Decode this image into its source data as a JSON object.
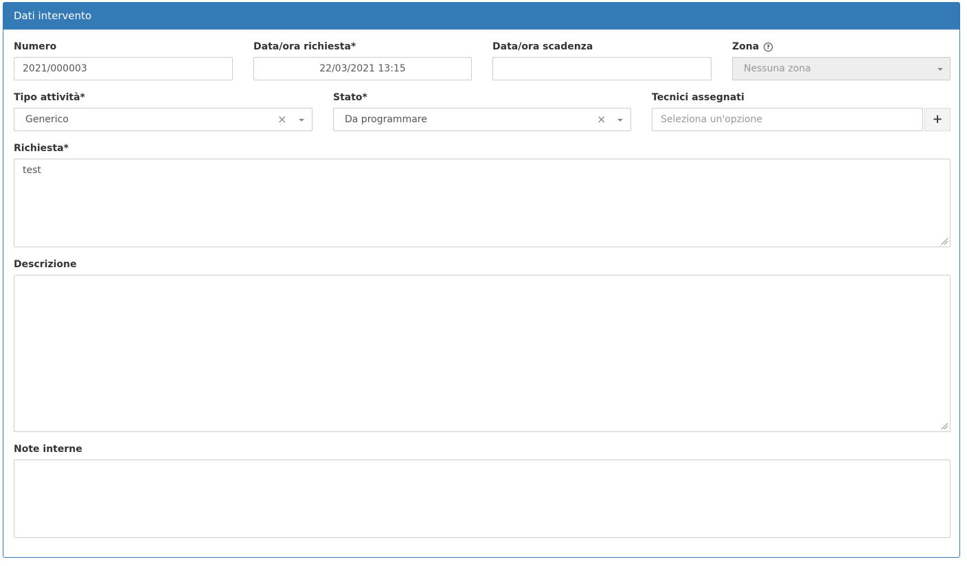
{
  "panel": {
    "title": "Dati intervento",
    "accent_color": "#337ab7"
  },
  "fields": {
    "numero": {
      "label": "Numero",
      "value": "2021/000003"
    },
    "data_richiesta": {
      "label": "Data/ora richiesta*",
      "value": "22/03/2021 13:15"
    },
    "data_scadenza": {
      "label": "Data/ora scadenza",
      "value": ""
    },
    "zona": {
      "label": "Zona",
      "value": "Nessuna zona",
      "help_icon": "question-circle-icon"
    },
    "tipo_attivita": {
      "label": "Tipo attività*",
      "value": "Generico",
      "clear": "×"
    },
    "stato": {
      "label": "Stato*",
      "value": "Da programmare",
      "clear": "×"
    },
    "tecnici": {
      "label": "Tecnici assegnati",
      "placeholder": "Seleziona un'opzione",
      "add_button": "+"
    },
    "richiesta": {
      "label": "Richiesta*",
      "value": "test"
    },
    "descrizione": {
      "label": "Descrizione",
      "value": ""
    },
    "note_interne": {
      "label": "Note interne",
      "value": ""
    }
  }
}
